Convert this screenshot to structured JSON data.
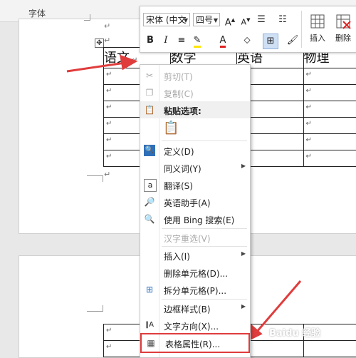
{
  "ribbon": {
    "group_label": "字体"
  },
  "minibar": {
    "font_name": "宋体 (中文",
    "font_size": "四号",
    "insert_label": "插入",
    "delete_label": "删除",
    "bold": "B",
    "italic": "I"
  },
  "table": {
    "headers": [
      "语文",
      "数学",
      "英语",
      "物理"
    ]
  },
  "menu": {
    "items": [
      {
        "label": "剪切(T)",
        "enabled": false,
        "icon": "scissors-icon"
      },
      {
        "label": "复制(C)",
        "enabled": false,
        "icon": "copy-icon"
      },
      {
        "label": "粘贴选项:",
        "enabled": true,
        "icon": "paste-icon"
      },
      {
        "label": "定义(D)",
        "enabled": true,
        "icon": "search-icon"
      },
      {
        "label": "同义词(Y)",
        "enabled": true,
        "submenu": true
      },
      {
        "label": "翻译(S)",
        "enabled": true,
        "icon": "translate-icon"
      },
      {
        "label": "英语助手(A)",
        "enabled": true,
        "icon": "dictionary-icon"
      },
      {
        "label": "使用 Bing 搜索(E)",
        "enabled": true,
        "icon": "bing-search-icon"
      },
      {
        "label": "汉字重选(V)",
        "enabled": false
      },
      {
        "label": "插入(I)",
        "enabled": true,
        "submenu": true
      },
      {
        "label": "删除单元格(D)...",
        "enabled": true
      },
      {
        "label": "拆分单元格(P)...",
        "enabled": true,
        "icon": "split-cells-icon"
      },
      {
        "label": "边框样式(B)",
        "enabled": true,
        "submenu": true
      },
      {
        "label": "文字方向(X)...",
        "enabled": true,
        "icon": "text-direction-icon"
      },
      {
        "label": "表格属性(R)...",
        "enabled": true,
        "icon": "table-properties-icon"
      }
    ]
  },
  "colors": {
    "annotation_red": "#e03c3c",
    "font_color_red": "#d22"
  },
  "watermark": "Baidu 经验"
}
